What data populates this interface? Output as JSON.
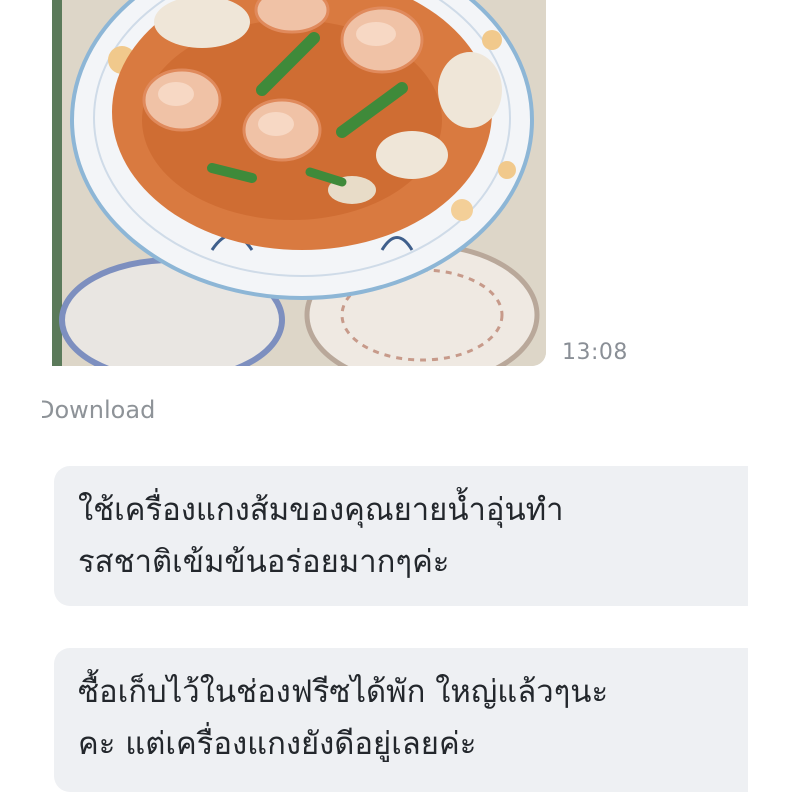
{
  "photo_message": {
    "alt": "",
    "timestamp": "13:08"
  },
  "download": {
    "label": "Download"
  },
  "messages": [
    {
      "lines": [
        "ใช้เครื่องแกงส้มของคุณยายน้ำอุ่นทำ",
        "รสชาติเข้มข้นอร่อยมากๆค่ะ"
      ]
    },
    {
      "lines": [
        "ซื้อเก็บไว้ในช่องฟรีซได้พัก ใหญ่แล้วๆนะ",
        "คะ แต่เครื่องแกงยังดีอยู่เลยค่ะ"
      ]
    }
  ],
  "colors": {
    "bubble_bg": "#eef0f3",
    "text": "#23272c",
    "muted": "#8a8f96",
    "curry": "#d9713a"
  }
}
